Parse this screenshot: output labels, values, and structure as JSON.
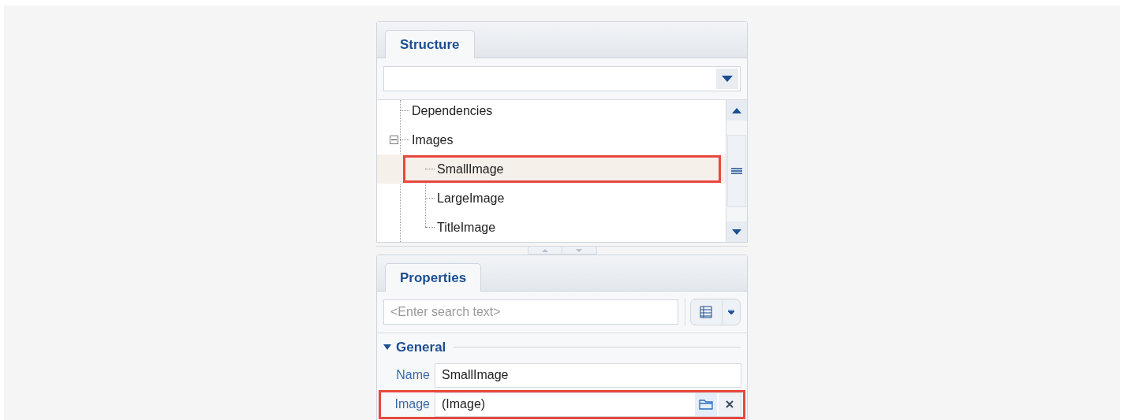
{
  "structure": {
    "tab": {
      "label": "Structure",
      "selected": true
    },
    "tree": [
      {
        "label": "Dependencies",
        "highlighted": false,
        "selected": false
      },
      {
        "label": "Images",
        "expanded": true,
        "highlighted": false,
        "selected": false,
        "children": [
          {
            "label": "SmallImage",
            "highlighted": true,
            "selected": true
          },
          {
            "label": "LargeImage",
            "highlighted": false,
            "selected": false
          },
          {
            "label": "TitleImage",
            "highlighted": false,
            "selected": false
          }
        ]
      }
    ]
  },
  "properties": {
    "tab": {
      "label": "Properties",
      "selected": true
    },
    "search": {
      "placeholder": "<Enter search text>"
    },
    "group": {
      "label": "General",
      "expanded": true
    },
    "rows": [
      {
        "label": "Name",
        "value": "SmallImage",
        "kind": "text",
        "highlighted": false
      },
      {
        "label": "Image",
        "value": "(Image)",
        "kind": "image",
        "highlighted": true
      }
    ]
  }
}
